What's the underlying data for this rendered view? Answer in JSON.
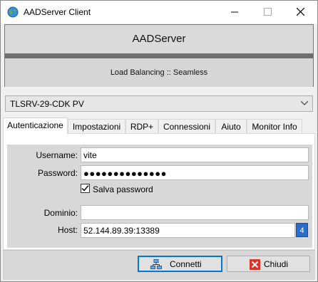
{
  "window": {
    "title": "AADServer Client"
  },
  "header": {
    "title": "AADServer",
    "subtitle": "Load Balancing :: Seamless"
  },
  "server_select": {
    "value": "TLSRV-29-CDK PV"
  },
  "tabs": [
    {
      "label": "Autenticazione",
      "active": true
    },
    {
      "label": "Impostazioni"
    },
    {
      "label": "RDP+"
    },
    {
      "label": "Connessioni"
    },
    {
      "label": "Aiuto"
    },
    {
      "label": "Monitor Info"
    }
  ],
  "auth": {
    "username_label": "Username:",
    "username_value": "vite",
    "password_label": "Password:",
    "password_value": "●●●●●●●●●●●●●●",
    "save_password_label": "Salva password",
    "save_password_checked": true,
    "domain_label": "Dominio:",
    "domain_value": "",
    "host_label": "Host:",
    "host_value": "52.144.89.39:13389",
    "host_badge": "4"
  },
  "buttons": {
    "connect_label": "Connetti",
    "close_label": "Chiudi"
  },
  "colors": {
    "accent": "#0078d7",
    "badge": "#2b6ec9",
    "close_icon": "#d9342b"
  }
}
